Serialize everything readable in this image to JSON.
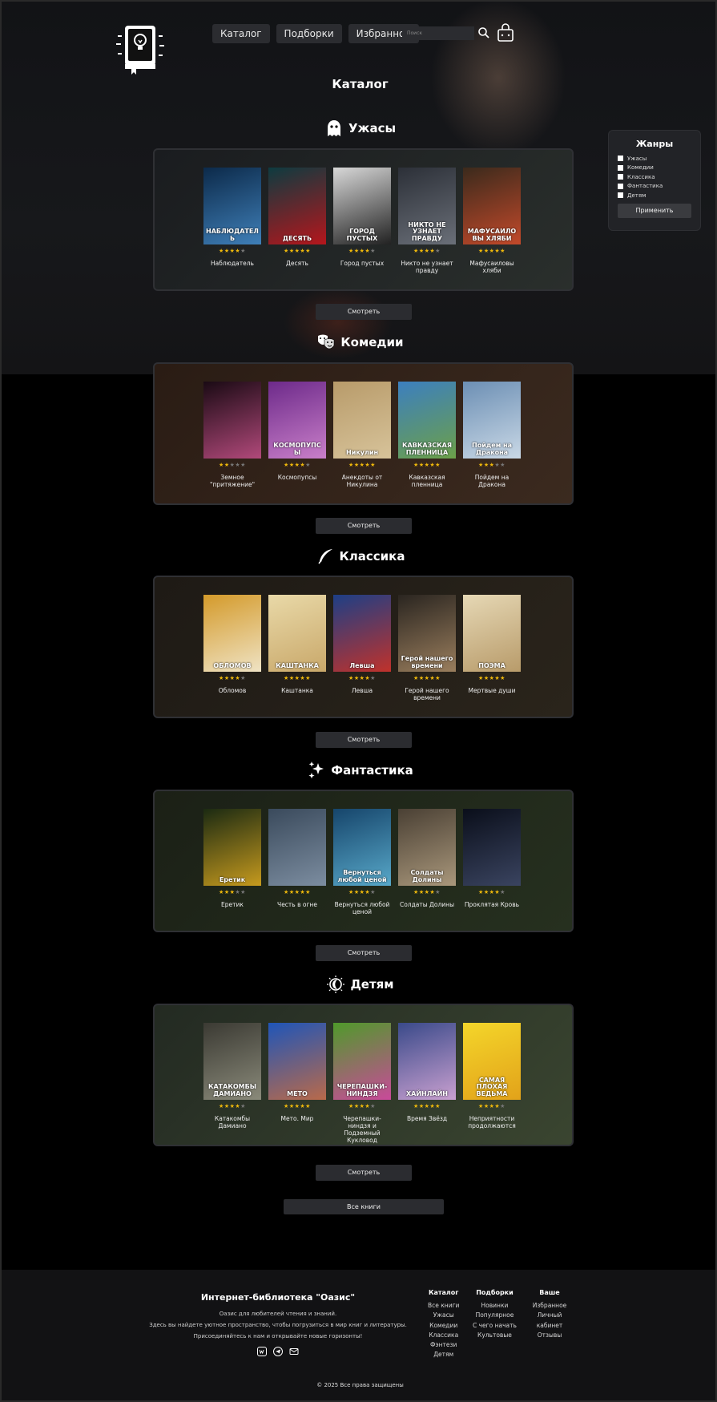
{
  "header": {
    "nav": [
      "Каталог",
      "Подборки",
      "Избранное"
    ],
    "search_placeholder": "Поиск"
  },
  "catalog_title": "Каталог",
  "genres_panel": {
    "title": "Жанры",
    "items": [
      "Ужасы",
      "Комедии",
      "Классика",
      "Фантастика",
      "Детям"
    ],
    "apply": "Применить"
  },
  "sections": [
    {
      "title": "Ужасы",
      "icon": "ghost-icon",
      "view_label": "Смотреть",
      "bg": [
        "#1a1c1f",
        "#2a2f2c"
      ],
      "books": [
        {
          "title": "Наблюдатель",
          "rating": 4,
          "cover_text": "НАБЛЮДАТЕЛЬ",
          "colors": [
            "#0c2a4a",
            "#3f7fb8"
          ]
        },
        {
          "title": "Десять",
          "rating": 5,
          "cover_text": "ДЕСЯТЬ",
          "colors": [
            "#0d3b40",
            "#b5161c"
          ]
        },
        {
          "title": "Город пустых",
          "rating": 4,
          "cover_text": "ГОРОД ПУСТЫХ",
          "colors": [
            "#d8d8d8",
            "#222222"
          ]
        },
        {
          "title": "Никто не узнает правду",
          "rating": 4,
          "cover_text": "НИКТО НЕ УЗНАЕТ ПРАВДУ",
          "colors": [
            "#2c3038",
            "#6a6f78"
          ]
        },
        {
          "title": "Мафусаиловы хляби",
          "rating": 5,
          "cover_text": "МАФУСАИЛОВЫ ХЛЯБИ",
          "colors": [
            "#3b2a1c",
            "#c2492a"
          ]
        }
      ]
    },
    {
      "title": "Комедии",
      "icon": "theater-masks-icon",
      "view_label": "Смотреть",
      "bg": [
        "#2a1c14",
        "#3b2a1f"
      ],
      "books": [
        {
          "title": "Земное \"притяжение\"",
          "rating": 2,
          "cover_text": "",
          "colors": [
            "#1a0a14",
            "#b1497a"
          ]
        },
        {
          "title": "Космопупсы",
          "rating": 4,
          "cover_text": "КОСМОПУПСЫ",
          "colors": [
            "#6d2a8a",
            "#c97fc9"
          ]
        },
        {
          "title": "Анекдоты от Никулина",
          "rating": 5,
          "cover_text": "Никулин",
          "colors": [
            "#b89b6a",
            "#d7c39a"
          ]
        },
        {
          "title": "Кавказская пленница",
          "rating": 5,
          "cover_text": "КАВКАЗСКАЯ ПЛЕННИЦА",
          "colors": [
            "#3c7fbf",
            "#6ca049"
          ]
        },
        {
          "title": "Пойдем на Дракона",
          "rating": 3,
          "cover_text": "Пойдем на Дракона",
          "colors": [
            "#6c8fb4",
            "#c9d8e6"
          ]
        }
      ]
    },
    {
      "title": "Классика",
      "icon": "quill-icon",
      "view_label": "Смотреть",
      "bg": [
        "#1e1a15",
        "#2a241b"
      ],
      "books": [
        {
          "title": "Обломов",
          "rating": 4,
          "cover_text": "ОБЛОМОВ",
          "colors": [
            "#d49a2a",
            "#efe3c4"
          ]
        },
        {
          "title": "Каштанка",
          "rating": 5,
          "cover_text": "КАШТАНКА",
          "colors": [
            "#e9d9a8",
            "#c9a86a"
          ]
        },
        {
          "title": "Левша",
          "rating": 4,
          "cover_text": "Левша",
          "colors": [
            "#1d3f86",
            "#c0322b"
          ]
        },
        {
          "title": "Герой нашего времени",
          "rating": 5,
          "cover_text": "Герой нашего времени",
          "colors": [
            "#2a2520",
            "#9a7e5d"
          ]
        },
        {
          "title": "Мертвые души",
          "rating": 5,
          "cover_text": "ПОЭМА",
          "colors": [
            "#e6d8b5",
            "#b89b6a"
          ]
        }
      ]
    },
    {
      "title": "Фантастика",
      "icon": "sparkles-icon",
      "view_label": "Смотреть",
      "bg": [
        "#1b2016",
        "#26301f"
      ],
      "books": [
        {
          "title": "Еретик",
          "rating": 3,
          "cover_text": "Еретик",
          "colors": [
            "#1b2a12",
            "#c69a1e"
          ]
        },
        {
          "title": "Честь в огне",
          "rating": 5,
          "cover_text": "",
          "colors": [
            "#3a4a5c",
            "#7c8da0"
          ]
        },
        {
          "title": "Вернуться любой ценой",
          "rating": 4,
          "cover_text": "Вернуться любой ценой",
          "colors": [
            "#16456b",
            "#58a8c9"
          ]
        },
        {
          "title": "Солдаты Долины",
          "rating": 4,
          "cover_text": "Солдаты Долины",
          "colors": [
            "#4a4034",
            "#a9977b"
          ]
        },
        {
          "title": "Проклятая Кровь",
          "rating": 4,
          "cover_text": "",
          "colors": [
            "#0a0e1a",
            "#3a4460"
          ]
        }
      ]
    },
    {
      "title": "Детям",
      "icon": "moon-icon",
      "view_label": "Смотреть",
      "bg": [
        "#232a22",
        "#3a4530"
      ],
      "books": [
        {
          "title": "Катакомбы Дамиано",
          "rating": 4,
          "cover_text": "КАТАКОМБЫ ДАМИАНО",
          "colors": [
            "#3b3a33",
            "#8a8a7a"
          ]
        },
        {
          "title": "Мето. Мир",
          "rating": 5,
          "cover_text": "МЕТО",
          "colors": [
            "#1f55b8",
            "#b96a4a"
          ]
        },
        {
          "title": "Черепашки-ниндзя и Подземный Кукловод",
          "rating": 4,
          "cover_text": "ЧЕРЕПАШКИ-НИНДЗЯ",
          "colors": [
            "#4f9a2a",
            "#c94a9a"
          ]
        },
        {
          "title": "Время Звёзд",
          "rating": 5,
          "cover_text": "ХАЙНЛАЙН",
          "colors": [
            "#3a4a8a",
            "#c9a0d0"
          ]
        },
        {
          "title": "Неприятности продолжаются",
          "rating": 4,
          "cover_text": "САМАЯ ПЛОХАЯ ВЕДЬМА",
          "colors": [
            "#f4d62a",
            "#e2a21a"
          ]
        }
      ]
    }
  ],
  "all_books": "Все книги",
  "footer": {
    "title": "Интернет-библиотека \"Оазис\"",
    "lines": [
      "Оазис для любителей чтения и знаний.",
      "Здесь вы найдете уютное пространство, чтобы погрузиться в мир книг и литературы.",
      "Присоединяйтесь к нам и открывайте новые горизонты!"
    ],
    "cols": [
      {
        "title": "Каталог",
        "items": [
          "Все книги",
          "Ужасы",
          "Комедии",
          "Классика",
          "Фэнтези",
          "Детям"
        ]
      },
      {
        "title": "Подборки",
        "items": [
          "Новинки",
          "Популярное",
          "С чего начать",
          "Культовые"
        ]
      },
      {
        "title": "Ваше",
        "items": [
          "Избранное",
          "Личный кабинет",
          "Отзывы"
        ]
      }
    ],
    "copyright": "© 2025 Все права защищены"
  }
}
